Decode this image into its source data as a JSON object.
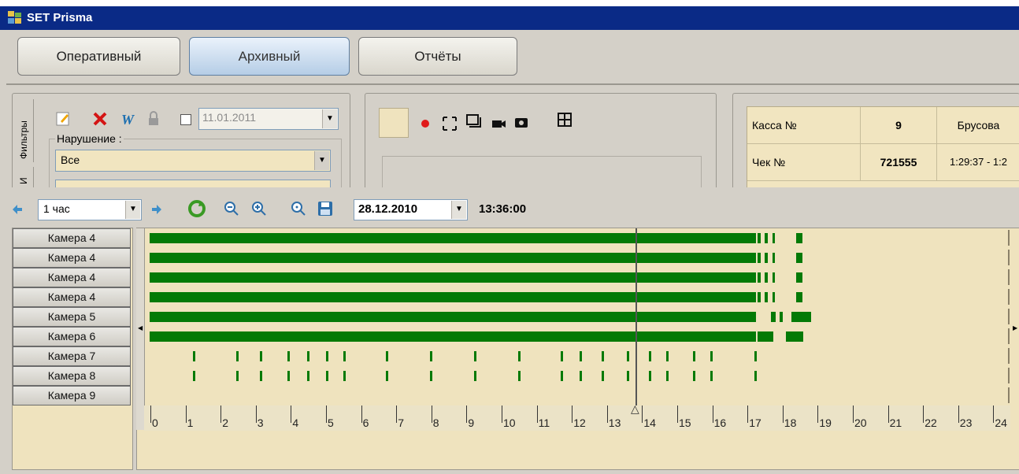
{
  "window": {
    "title": "SET Prisma"
  },
  "modes": [
    "Оперативный",
    "Архивный",
    "Отчёты"
  ],
  "filters": {
    "tab_label": "Фильтры",
    "tab2_label": "И",
    "date_value": "11.01.2011",
    "violation_label": "Нарушение :",
    "violation_value": "Все"
  },
  "receipt": {
    "rows": [
      {
        "label": "Касса №",
        "value": "9",
        "extra": "Брусова"
      },
      {
        "label": "Чек №",
        "value": "721555",
        "extra": "1:29:37 - 1:2"
      }
    ]
  },
  "timeline": {
    "interval": "1 час",
    "date": "28.12.2010",
    "time": "13:36:00",
    "cameras": [
      "Камера 4",
      "Камера 4",
      "Камера 4",
      "Камера 4",
      "Камера 5",
      "Камера 6",
      "Камера 7",
      "Камера 8",
      "Камера 9"
    ],
    "hours": [
      "0",
      "1",
      "2",
      "3",
      "4",
      "5",
      "6",
      "7",
      "8",
      "9",
      "10",
      "11",
      "12",
      "13",
      "14",
      "15",
      "16",
      "17",
      "18",
      "19",
      "20",
      "21",
      "22",
      "23",
      "24"
    ]
  },
  "colors": {
    "titlebar": "#0a2a86",
    "recording": "#037a06",
    "track": "#efe3be"
  },
  "icons": [
    "edit-icon",
    "delete-icon",
    "word-export-icon",
    "lock-icon",
    "record-icon",
    "fullscreen-icon",
    "snapshot-icon",
    "camera-icon",
    "photo-icon",
    "grid-icon",
    "arrow-left-icon",
    "arrow-right-icon",
    "refresh-icon",
    "zoom-out-icon",
    "zoom-in-icon",
    "zoom-reset-icon",
    "save-icon"
  ]
}
